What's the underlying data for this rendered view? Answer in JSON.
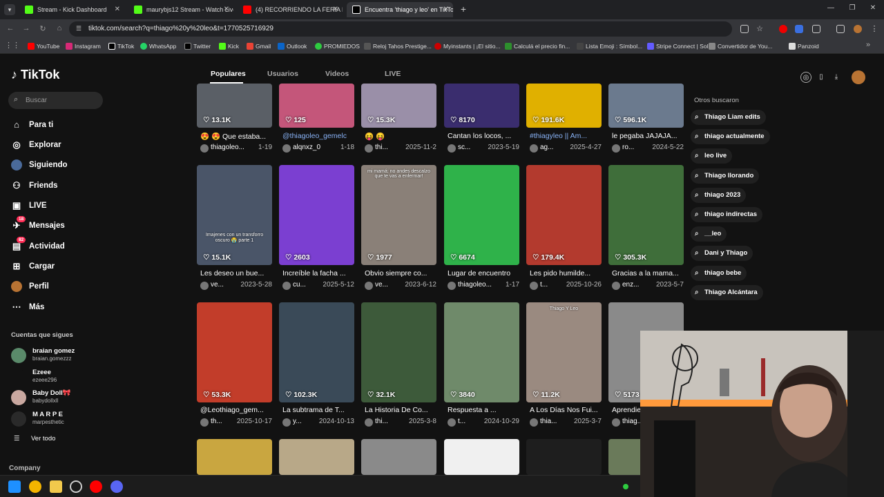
{
  "browser": {
    "tabs": [
      {
        "title": "Stream - Kick Dashboard",
        "color": "#53fc18"
      },
      {
        "title": "maurybjs12 Stream - Watch Live",
        "color": "#53fc18"
      },
      {
        "title": "(4) RECORRIENDO LA FERIA MA",
        "color": "#ff0000"
      },
      {
        "title": "Encuentra 'thiago y leo' en TikTok",
        "color": "#ffffff"
      }
    ],
    "url": "tiktok.com/search?q=thiago%20y%20leo&t=1770525716929",
    "bookmarks": [
      "YouTube",
      "Instagram",
      "TikTok",
      "WhatsApp",
      "Twitter",
      "Kick",
      "Gmail",
      "Outlook",
      "PROMIEDOS",
      "Reloj Tahos Prestige...",
      "Myinstants | ¡El sitio...",
      "Calculá el precio fin...",
      "Lista Emoji : Símbol...",
      "Stripe Connect | Sol...",
      "Convertidor de You...",
      "Panzoid"
    ]
  },
  "tiktok": {
    "logo": "TikTok",
    "search_placeholder": "Buscar",
    "nav": [
      {
        "label": "Para ti",
        "icon": "home-icon"
      },
      {
        "label": "Explorar",
        "icon": "compass-icon"
      },
      {
        "label": "Siguiendo",
        "icon": "following-icon"
      },
      {
        "label": "Friends",
        "icon": "friends-icon"
      },
      {
        "label": "LIVE",
        "icon": "live-icon"
      },
      {
        "label": "Mensajes",
        "icon": "message-icon",
        "badge": "18"
      },
      {
        "label": "Actividad",
        "icon": "inbox-icon",
        "badge": "82"
      },
      {
        "label": "Cargar",
        "icon": "upload-icon"
      },
      {
        "label": "Perfil",
        "icon": "avatar-icon"
      },
      {
        "label": "Más",
        "icon": "more-icon"
      }
    ],
    "following_header": "Cuentas que sigues",
    "following": [
      {
        "name": "braian gomez",
        "handle": "braian.gomezzz"
      },
      {
        "name": "Ezeee",
        "handle": "ezeee296"
      },
      {
        "name": "Baby Doll🎀",
        "handle": "babydollxll"
      },
      {
        "name": "M A R P E",
        "handle": "marpesthetic"
      }
    ],
    "see_all": "Ver todo",
    "company": "Company",
    "tabs": [
      "Populares",
      "Usuarios",
      "Videos",
      "LIVE"
    ],
    "others_header": "Otros buscaron",
    "others": [
      "Thiago Liam edits",
      "thiago actualmente",
      "leo live",
      "Thiago llorando",
      "thiago 2023",
      "thiago indirectas",
      "__leo",
      "Dani y Thiago",
      "thiago bebe",
      "Thiago Alcántara"
    ],
    "videos_row1": [
      {
        "views": "13.1K",
        "title": "😍 😍 Que estaba...",
        "user": "thiagoleo...",
        "date": "1-19",
        "bg": "#5a5f66"
      },
      {
        "views": "125",
        "title": "@thiagoleo_gemelc",
        "user": "alqnxz_0",
        "date": "1-18",
        "bg": "#c4567a",
        "blue": true
      },
      {
        "views": "15.3K",
        "title": "😝 😝",
        "user": "thi...",
        "date": "2025-11-2",
        "bg": "#9a8fa8"
      },
      {
        "views": "8170",
        "title": "Cantan los locos, ...",
        "user": "sc...",
        "date": "2023-5-19",
        "bg": "#3a2d6e"
      },
      {
        "views": "191.6K",
        "title": "#thiagyleo || Am...",
        "user": "ag...",
        "date": "2025-4-27",
        "bg": "#e0b000",
        "blue": true
      },
      {
        "views": "596.1K",
        "title": "le pegaba JAJAJA...",
        "user": "ro...",
        "date": "2024-5-22",
        "bg": "#6b7a8e"
      }
    ],
    "videos_row2": [
      {
        "views": "15.1K",
        "title": "Les deseo un bue...",
        "user": "ve...",
        "date": "2023-5-28",
        "bg": "#4a5568",
        "cap": "Imajenes con un transforro oscuro 😭 parte 1"
      },
      {
        "views": "2603",
        "title": "Increíble la facha ...",
        "user": "cu...",
        "date": "2025-5-12",
        "bg": "#7b3fd1"
      },
      {
        "views": "1977",
        "title": "Obvio siempre co...",
        "user": "ve...",
        "date": "2023-6-12",
        "bg": "#8a8078",
        "cap": "mi mamá: no andes descalzo que te vas a enfermar!"
      },
      {
        "views": "6674",
        "title": "Lugar de encuentro",
        "user": "thiagoleo...",
        "date": "1-17",
        "bg": "#2fb24a"
      },
      {
        "views": "179.4K",
        "title": "Les pido humilde...",
        "user": "t...",
        "date": "2025-10-26",
        "bg": "#b33a2e"
      },
      {
        "views": "305.3K",
        "title": "Gracias a la mama...",
        "user": "enz...",
        "date": "2023-5-7",
        "bg": "#3f6e3a"
      }
    ],
    "videos_row3": [
      {
        "views": "53.3K",
        "title": "@Leothiago_gem...",
        "user": "th...",
        "date": "2025-10-17",
        "bg": "#c23d2a"
      },
      {
        "views": "102.3K",
        "title": "La subtrama de T...",
        "user": "y...",
        "date": "2024-10-13",
        "bg": "#3a4a58"
      },
      {
        "views": "32.1K",
        "title": "La Historia De Co...",
        "user": "thi...",
        "date": "2025-3-8",
        "bg": "#3d5a3a"
      },
      {
        "views": "3840",
        "title": "Respuesta a ...",
        "user": "t...",
        "date": "2024-10-29",
        "bg": "#6f8a6a"
      },
      {
        "views": "11.2K",
        "title": "A Los Días Nos Fui...",
        "user": "thia...",
        "date": "2025-3-7",
        "bg": "#9a8a80",
        "cap": "Thiago Y Leo"
      },
      {
        "views": "5173",
        "title": "Aprendie...",
        "user": "thiag...",
        "date": "",
        "bg": "#8a8a8a"
      }
    ],
    "videos_row4_bg": [
      "#c9a640",
      "#b8a888",
      "#8a8a8a",
      "#f0f0f0",
      "#1e1e1e",
      "#6a7a5a"
    ]
  },
  "colors": {
    "accent": "#fe2c55",
    "bg": "#121212"
  }
}
